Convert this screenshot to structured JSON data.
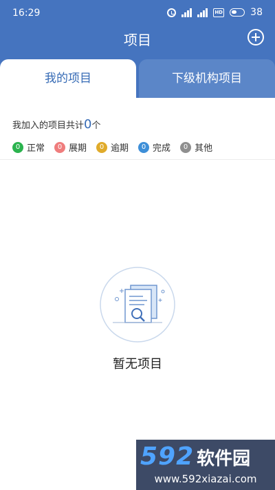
{
  "status_bar": {
    "time": "16:29",
    "battery_level": "38",
    "icons": [
      "alarm-icon",
      "signal-icon",
      "signal-icon",
      "hd-icon",
      "battery-icon"
    ]
  },
  "header": {
    "title": "项目",
    "add_icon": "plus-circle-icon",
    "background_color": "#4574bf"
  },
  "tabs": [
    {
      "label": "我的项目",
      "active": true
    },
    {
      "label": "下级机构项目",
      "active": false
    }
  ],
  "summary": {
    "prefix": "我加入的项目共计",
    "count": "0",
    "suffix": "个"
  },
  "legend": [
    {
      "count": "0",
      "label": "正常",
      "color": "#2bb34e"
    },
    {
      "count": "0",
      "label": "展期",
      "color": "#ef7d7d"
    },
    {
      "count": "0",
      "label": "逾期",
      "color": "#e0ab2b"
    },
    {
      "count": "0",
      "label": "完成",
      "color": "#3e8fd8"
    },
    {
      "count": "0",
      "label": "其他",
      "color": "#8f8f8f"
    }
  ],
  "empty_state": {
    "icon": "document-search-icon",
    "text": "暂无项目"
  },
  "watermark": {
    "logo_number": "592",
    "logo_text": "软件园",
    "url": "www.592xiazai.com"
  }
}
